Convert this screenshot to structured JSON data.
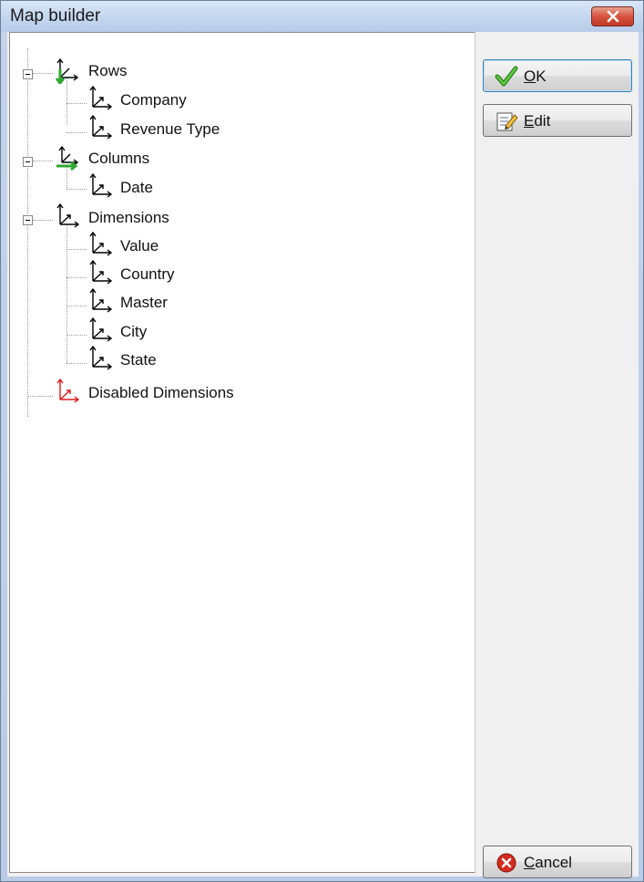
{
  "window": {
    "title": "Map builder"
  },
  "tree": {
    "rows": {
      "label": "Rows",
      "children": [
        "Company",
        "Revenue Type"
      ]
    },
    "columns": {
      "label": "Columns",
      "children": [
        "Date"
      ]
    },
    "dimensions": {
      "label": "Dimensions",
      "children": [
        "Value",
        "Country",
        "Master",
        "City",
        "State"
      ]
    },
    "disabled": {
      "label": "Disabled Dimensions"
    }
  },
  "buttons": {
    "ok": {
      "accel": "O",
      "rest": "K"
    },
    "edit": {
      "accel": "E",
      "rest": "dit"
    },
    "cancel": {
      "accel": "C",
      "rest": "ancel"
    }
  },
  "colors": {
    "rows_accent": "#2ea82e",
    "columns_accent": "#2ea82e",
    "disabled_accent": "#e01818"
  }
}
